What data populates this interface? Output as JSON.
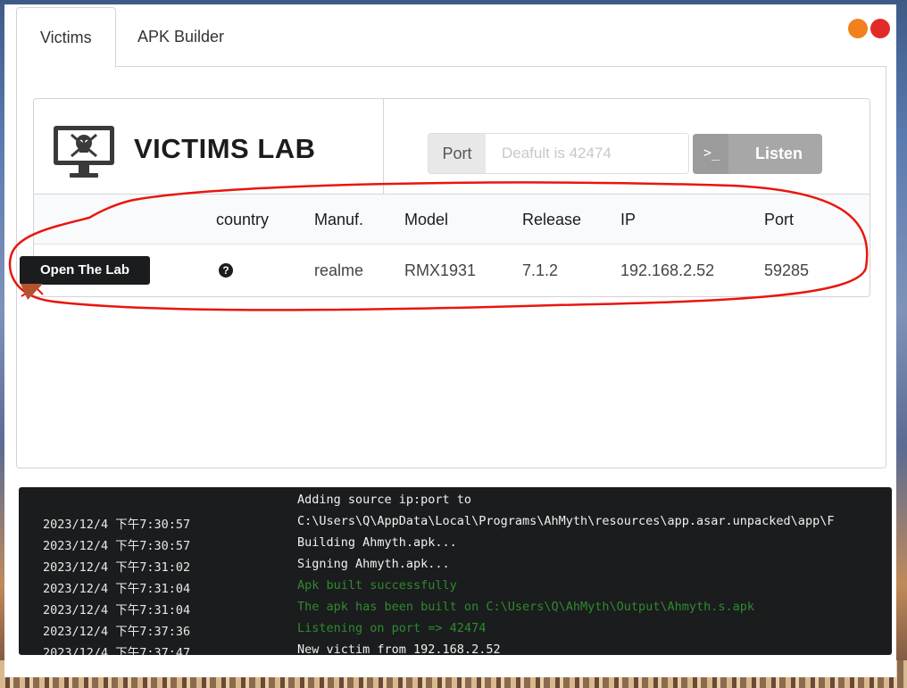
{
  "tabs": {
    "victims": "Victims",
    "apk_builder": "APK Builder"
  },
  "header": {
    "title": "VICTIMS LAB"
  },
  "listener": {
    "port_label": "Port",
    "port_placeholder": "Deafult is 42474",
    "listen_label": "Listen",
    "listen_icon": ">_"
  },
  "table": {
    "headers": [
      "country",
      "Manuf.",
      "Model",
      "Release",
      "IP",
      "Port"
    ],
    "rows": [
      {
        "action": "Open The Lab",
        "country": "?",
        "manuf": "realme",
        "model": "RMX1931",
        "release": "7.1.2",
        "ip": "192.168.2.52",
        "port": "59285"
      }
    ]
  },
  "logs": [
    {
      "time": "",
      "message": "Adding source ip:port to",
      "color": "white"
    },
    {
      "time": "2023/12/4 下午7:30:57",
      "message": "C:\\Users\\Q\\AppData\\Local\\Programs\\AhMyth\\resources\\app.asar.unpacked\\app\\F",
      "color": "white"
    },
    {
      "time": "2023/12/4 下午7:30:57",
      "message": "Building Ahmyth.apk...",
      "color": "white"
    },
    {
      "time": "2023/12/4 下午7:31:02",
      "message": "Signing Ahmyth.apk...",
      "color": "white"
    },
    {
      "time": "2023/12/4 下午7:31:04",
      "message": "Apk built successfully",
      "color": "green"
    },
    {
      "time": "2023/12/4 下午7:31:04",
      "message": "The apk has been built on C:\\Users\\Q\\AhMyth\\Output\\Ahmyth.s.apk",
      "color": "green"
    },
    {
      "time": "2023/12/4 下午7:37:36",
      "message": "Listening on port => 42474",
      "color": "green"
    },
    {
      "time": "2023/12/4 下午7:37:47",
      "message": "New victim from 192.168.2.52",
      "color": "white"
    }
  ],
  "colors": {
    "minimize": "#f2801e",
    "close": "#e02b27",
    "annotation": "#e8160e",
    "success": "#2e8b2e"
  },
  "icons": {
    "monitor": "skull-monitor-icon",
    "help": "question-circle-icon"
  }
}
